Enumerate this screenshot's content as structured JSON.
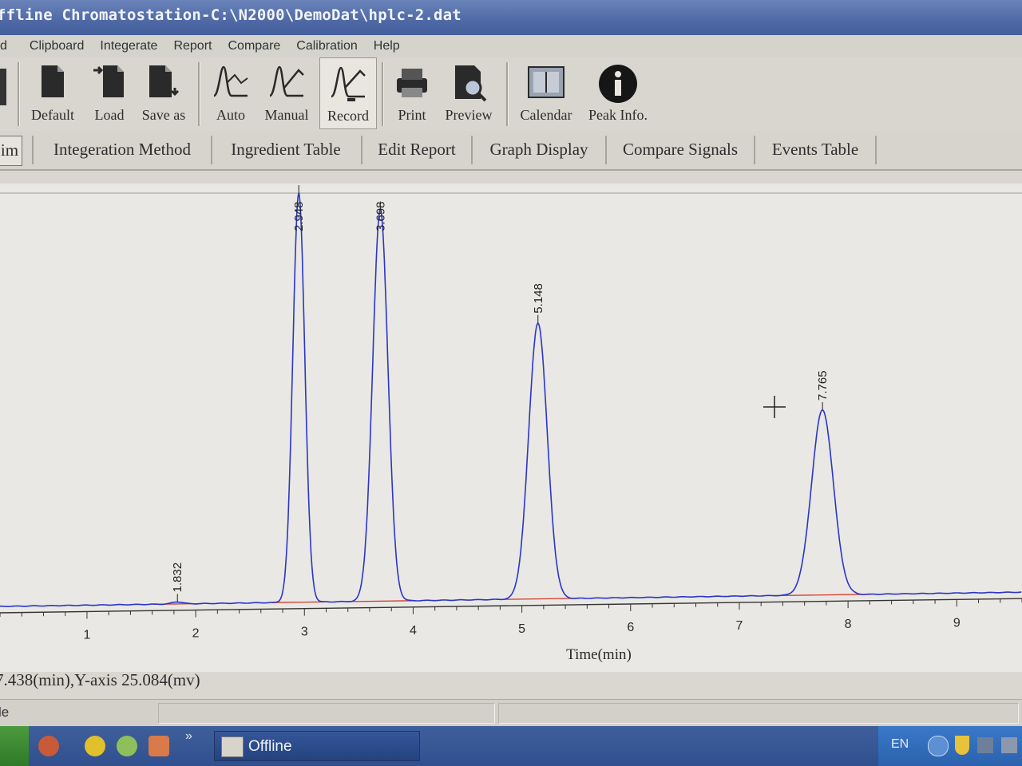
{
  "window": {
    "title": "ffline Chromatostation-C:\\N2000\\DemoDat\\hplc-2.dat"
  },
  "menu": {
    "items": [
      "d",
      "Clipboard",
      "Integerate",
      "Report",
      "Compare",
      "Calibration",
      "Help"
    ]
  },
  "toolbar": {
    "buttons": [
      {
        "label": "Default",
        "icon": "document-icon"
      },
      {
        "label": "Load",
        "icon": "load-document-icon"
      },
      {
        "label": "Save as",
        "icon": "save-as-icon"
      },
      {
        "label": "Auto",
        "icon": "auto-integrate-icon"
      },
      {
        "label": "Manual",
        "icon": "manual-integrate-icon"
      },
      {
        "label": "Record",
        "icon": "record-integrate-icon"
      },
      {
        "label": "Print",
        "icon": "printer-icon"
      },
      {
        "label": "Preview",
        "icon": "print-preview-icon"
      },
      {
        "label": "Calendar",
        "icon": "calendar-icon"
      },
      {
        "label": "Peak Info.",
        "icon": "info-icon"
      }
    ]
  },
  "tabs": [
    "im",
    "Integeration Method",
    "Ingredient Table",
    "Edit Report",
    "Graph Display",
    "Compare Signals",
    "Events Table"
  ],
  "chart_data": {
    "type": "line",
    "xlabel": "Time(min)",
    "ylabel": "",
    "xlim": [
      0.2,
      9.6
    ],
    "ylim": [
      0,
      100
    ],
    "x_ticks": [
      1,
      2,
      3,
      4,
      5,
      6,
      7,
      8,
      9
    ],
    "grid": false,
    "colors": {
      "signal": "#2b35c7",
      "baseline": "#d23a2a"
    },
    "peaks": [
      {
        "time": 1.832,
        "label": "1.832",
        "height": 0.5,
        "width": 0.05
      },
      {
        "time": 2.948,
        "label": "2.948",
        "height": 100,
        "width": 0.055
      },
      {
        "time": 3.698,
        "label": "3.698",
        "height": 96,
        "width": 0.07
      },
      {
        "time": 5.148,
        "label": "5.148",
        "height": 68,
        "width": 0.085
      },
      {
        "time": 7.765,
        "label": "7.765",
        "height": 46,
        "width": 0.1
      }
    ]
  },
  "status": {
    "coordinates": "7.438(min),Y-axis 25.084(mv)",
    "left_text": "le"
  },
  "taskbar": {
    "task": "Offline",
    "chevron": "»",
    "lang": "EN"
  }
}
